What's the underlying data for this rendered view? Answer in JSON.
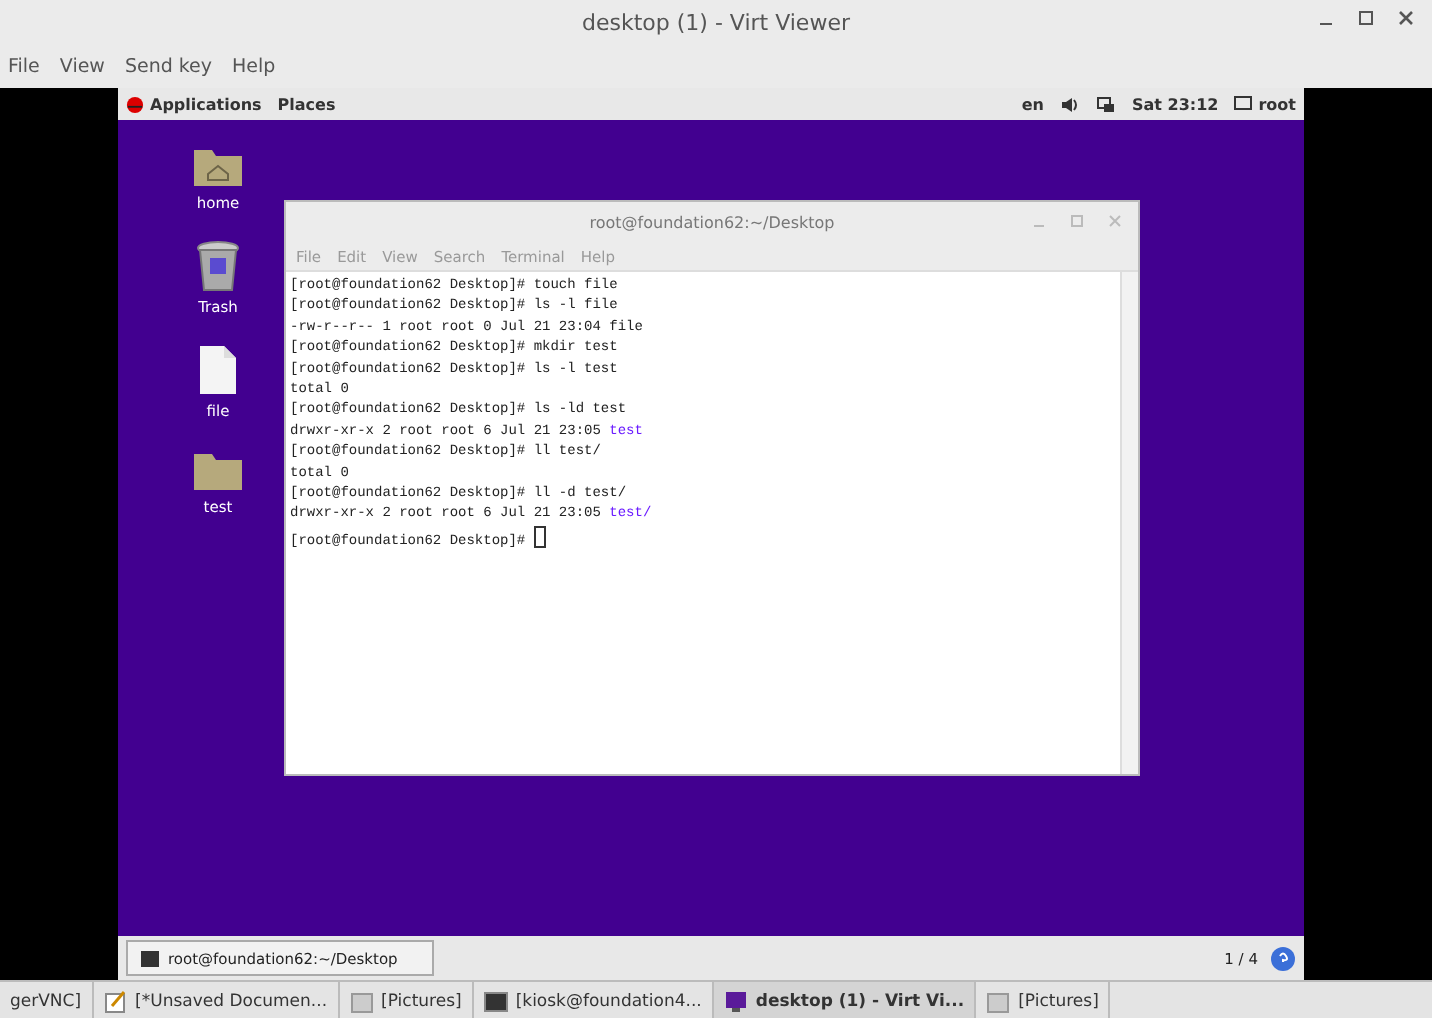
{
  "window": {
    "title": "desktop (1) - Virt Viewer"
  },
  "menu": [
    "File",
    "View",
    "Send key",
    "Help"
  ],
  "guest_panel": {
    "applications": "Applications",
    "places": "Places",
    "language": "en",
    "clock": "Sat 23:12",
    "user": "root"
  },
  "desktop_icons": [
    {
      "label": "home",
      "kind": "home"
    },
    {
      "label": "Trash",
      "kind": "trash"
    },
    {
      "label": "file",
      "kind": "file"
    },
    {
      "label": "test",
      "kind": "folder"
    }
  ],
  "terminal": {
    "title": "root@foundation62:~/Desktop",
    "menu": [
      "File",
      "Edit",
      "View",
      "Search",
      "Terminal",
      "Help"
    ],
    "lines": [
      {
        "text": "[root@foundation62 Desktop]# touch file"
      },
      {
        "text": "[root@foundation62 Desktop]# ls -l file"
      },
      {
        "text": "-rw-r--r-- 1 root root 0 Jul 21 23:04 file"
      },
      {
        "text": "[root@foundation62 Desktop]# mkdir test"
      },
      {
        "text": "[root@foundation62 Desktop]# ls -l test"
      },
      {
        "text": "total 0"
      },
      {
        "text": "[root@foundation62 Desktop]# ls -ld test"
      },
      {
        "text": "drwxr-xr-x 2 root root 6 Jul 21 23:05 ",
        "dir": "test"
      },
      {
        "text": "[root@foundation62 Desktop]# ll test/"
      },
      {
        "text": "total 0"
      },
      {
        "text": "[root@foundation62 Desktop]# ll -d test/"
      },
      {
        "text": "drwxr-xr-x 2 root root 6 Jul 21 23:05 ",
        "dir": "test/"
      },
      {
        "text": "[root@foundation62 Desktop]# ",
        "cursor": true
      }
    ]
  },
  "guest_taskbar": {
    "tasks": [
      {
        "label": "root@foundation62:~/Desktop"
      }
    ],
    "workspace": "1 / 4"
  },
  "host_taskbar": [
    {
      "label": "gerVNC]",
      "kind": "plain",
      "selected": false
    },
    {
      "label": "[*Unsaved Documen...",
      "kind": "editor",
      "selected": false
    },
    {
      "label": "[Pictures]",
      "kind": "folder",
      "selected": false
    },
    {
      "label": "[kiosk@foundation4...",
      "kind": "terminal",
      "selected": false
    },
    {
      "label": "desktop (1) - Virt Vi...",
      "kind": "viewer",
      "selected": true
    },
    {
      "label": "[Pictures]",
      "kind": "folder",
      "selected": false
    }
  ]
}
